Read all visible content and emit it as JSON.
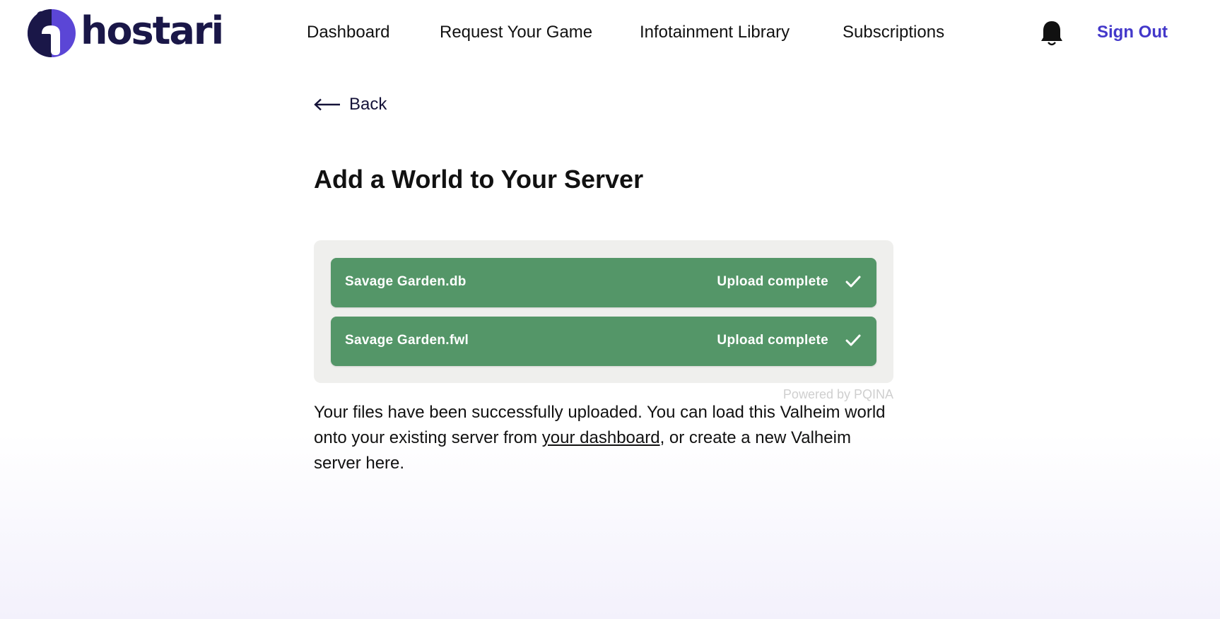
{
  "header": {
    "logo_text": "hostari",
    "nav": [
      {
        "label": "Dashboard"
      },
      {
        "label": "Request Your Game"
      },
      {
        "label": "Infotainment Library"
      },
      {
        "label": "Subscriptions"
      }
    ],
    "notification_icon": "bell-icon",
    "sign_out_label": "Sign Out"
  },
  "back": {
    "icon": "arrow-left-icon",
    "label": "Back"
  },
  "page_title": "Add a World to Your Server",
  "uploader": {
    "files": [
      {
        "name": "Savage Garden.db",
        "status": "Upload complete",
        "icon": "checkmark-icon"
      },
      {
        "name": "Savage Garden.fwl",
        "status": "Upload complete",
        "icon": "checkmark-icon"
      }
    ],
    "powered_by": "Powered by PQINA"
  },
  "message": {
    "part1": "Your files have been successfully uploaded. You can load this Valheim world onto your existing server from ",
    "link": "your dashboard",
    "part2": ", or create a new Valheim server here."
  },
  "colors": {
    "brand_dark": "#1a1748",
    "brand_accent": "#4338ca",
    "upload_success": "#549668",
    "dropzone_bg": "#efefed"
  }
}
